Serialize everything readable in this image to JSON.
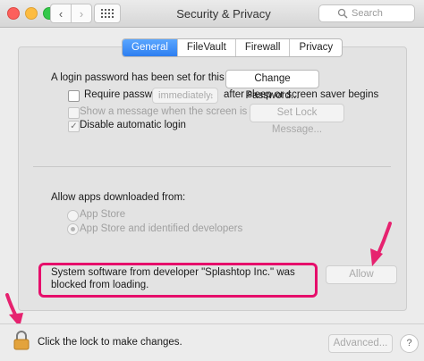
{
  "window": {
    "title": "Security & Privacy"
  },
  "search": {
    "placeholder": "Search"
  },
  "tabs": [
    {
      "label": "General",
      "active": true
    },
    {
      "label": "FileVault",
      "active": false
    },
    {
      "label": "Firewall",
      "active": false
    },
    {
      "label": "Privacy",
      "active": false
    }
  ],
  "general": {
    "login_password_text": "A login password has been set for this user",
    "change_password_label": "Change Password...",
    "require_password_label": "Require password",
    "require_password_value": "immediately",
    "require_password_suffix": "after sleep or screen saver begins",
    "show_message_label": "Show a message when the screen is locked",
    "set_lock_message_label": "Set Lock Message...",
    "disable_auto_login_label": "Disable automatic login",
    "allow_apps_heading": "Allow apps downloaded from:",
    "radio_app_store": "App Store",
    "radio_app_store_identified": "App Store and identified developers",
    "blocked_message": "System software from developer \"Splashtop Inc.\" was blocked from loading.",
    "allow_label": "Allow"
  },
  "footer": {
    "lock_text": "Click the lock to make changes.",
    "advanced_label": "Advanced..."
  },
  "colors": {
    "highlight": "#e60e6b",
    "arrow": "#e6226f",
    "tab_active": "#2d7ef0"
  }
}
